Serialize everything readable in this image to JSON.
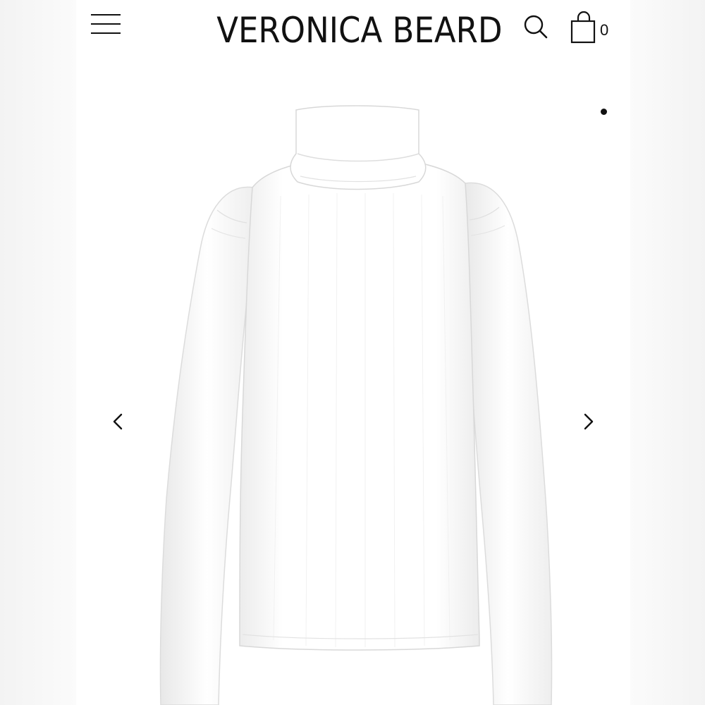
{
  "header": {
    "brand": "VERONICA BEARD",
    "menu_icon": "hamburger-menu-icon",
    "search_icon": "search-icon",
    "bag_icon": "shopping-bag-icon",
    "bag_count": "0"
  },
  "gallery": {
    "prev_icon": "chevron-left-icon",
    "next_icon": "chevron-right-icon",
    "image_subject": "white ribbed turtleneck long-sleeve top with puff shoulders",
    "active_dot_icon": "carousel-dot-icon"
  },
  "colors": {
    "text": "#111111",
    "background": "#ffffff",
    "garment": "#ffffff",
    "garment_shadow": "#e6e6e6"
  }
}
